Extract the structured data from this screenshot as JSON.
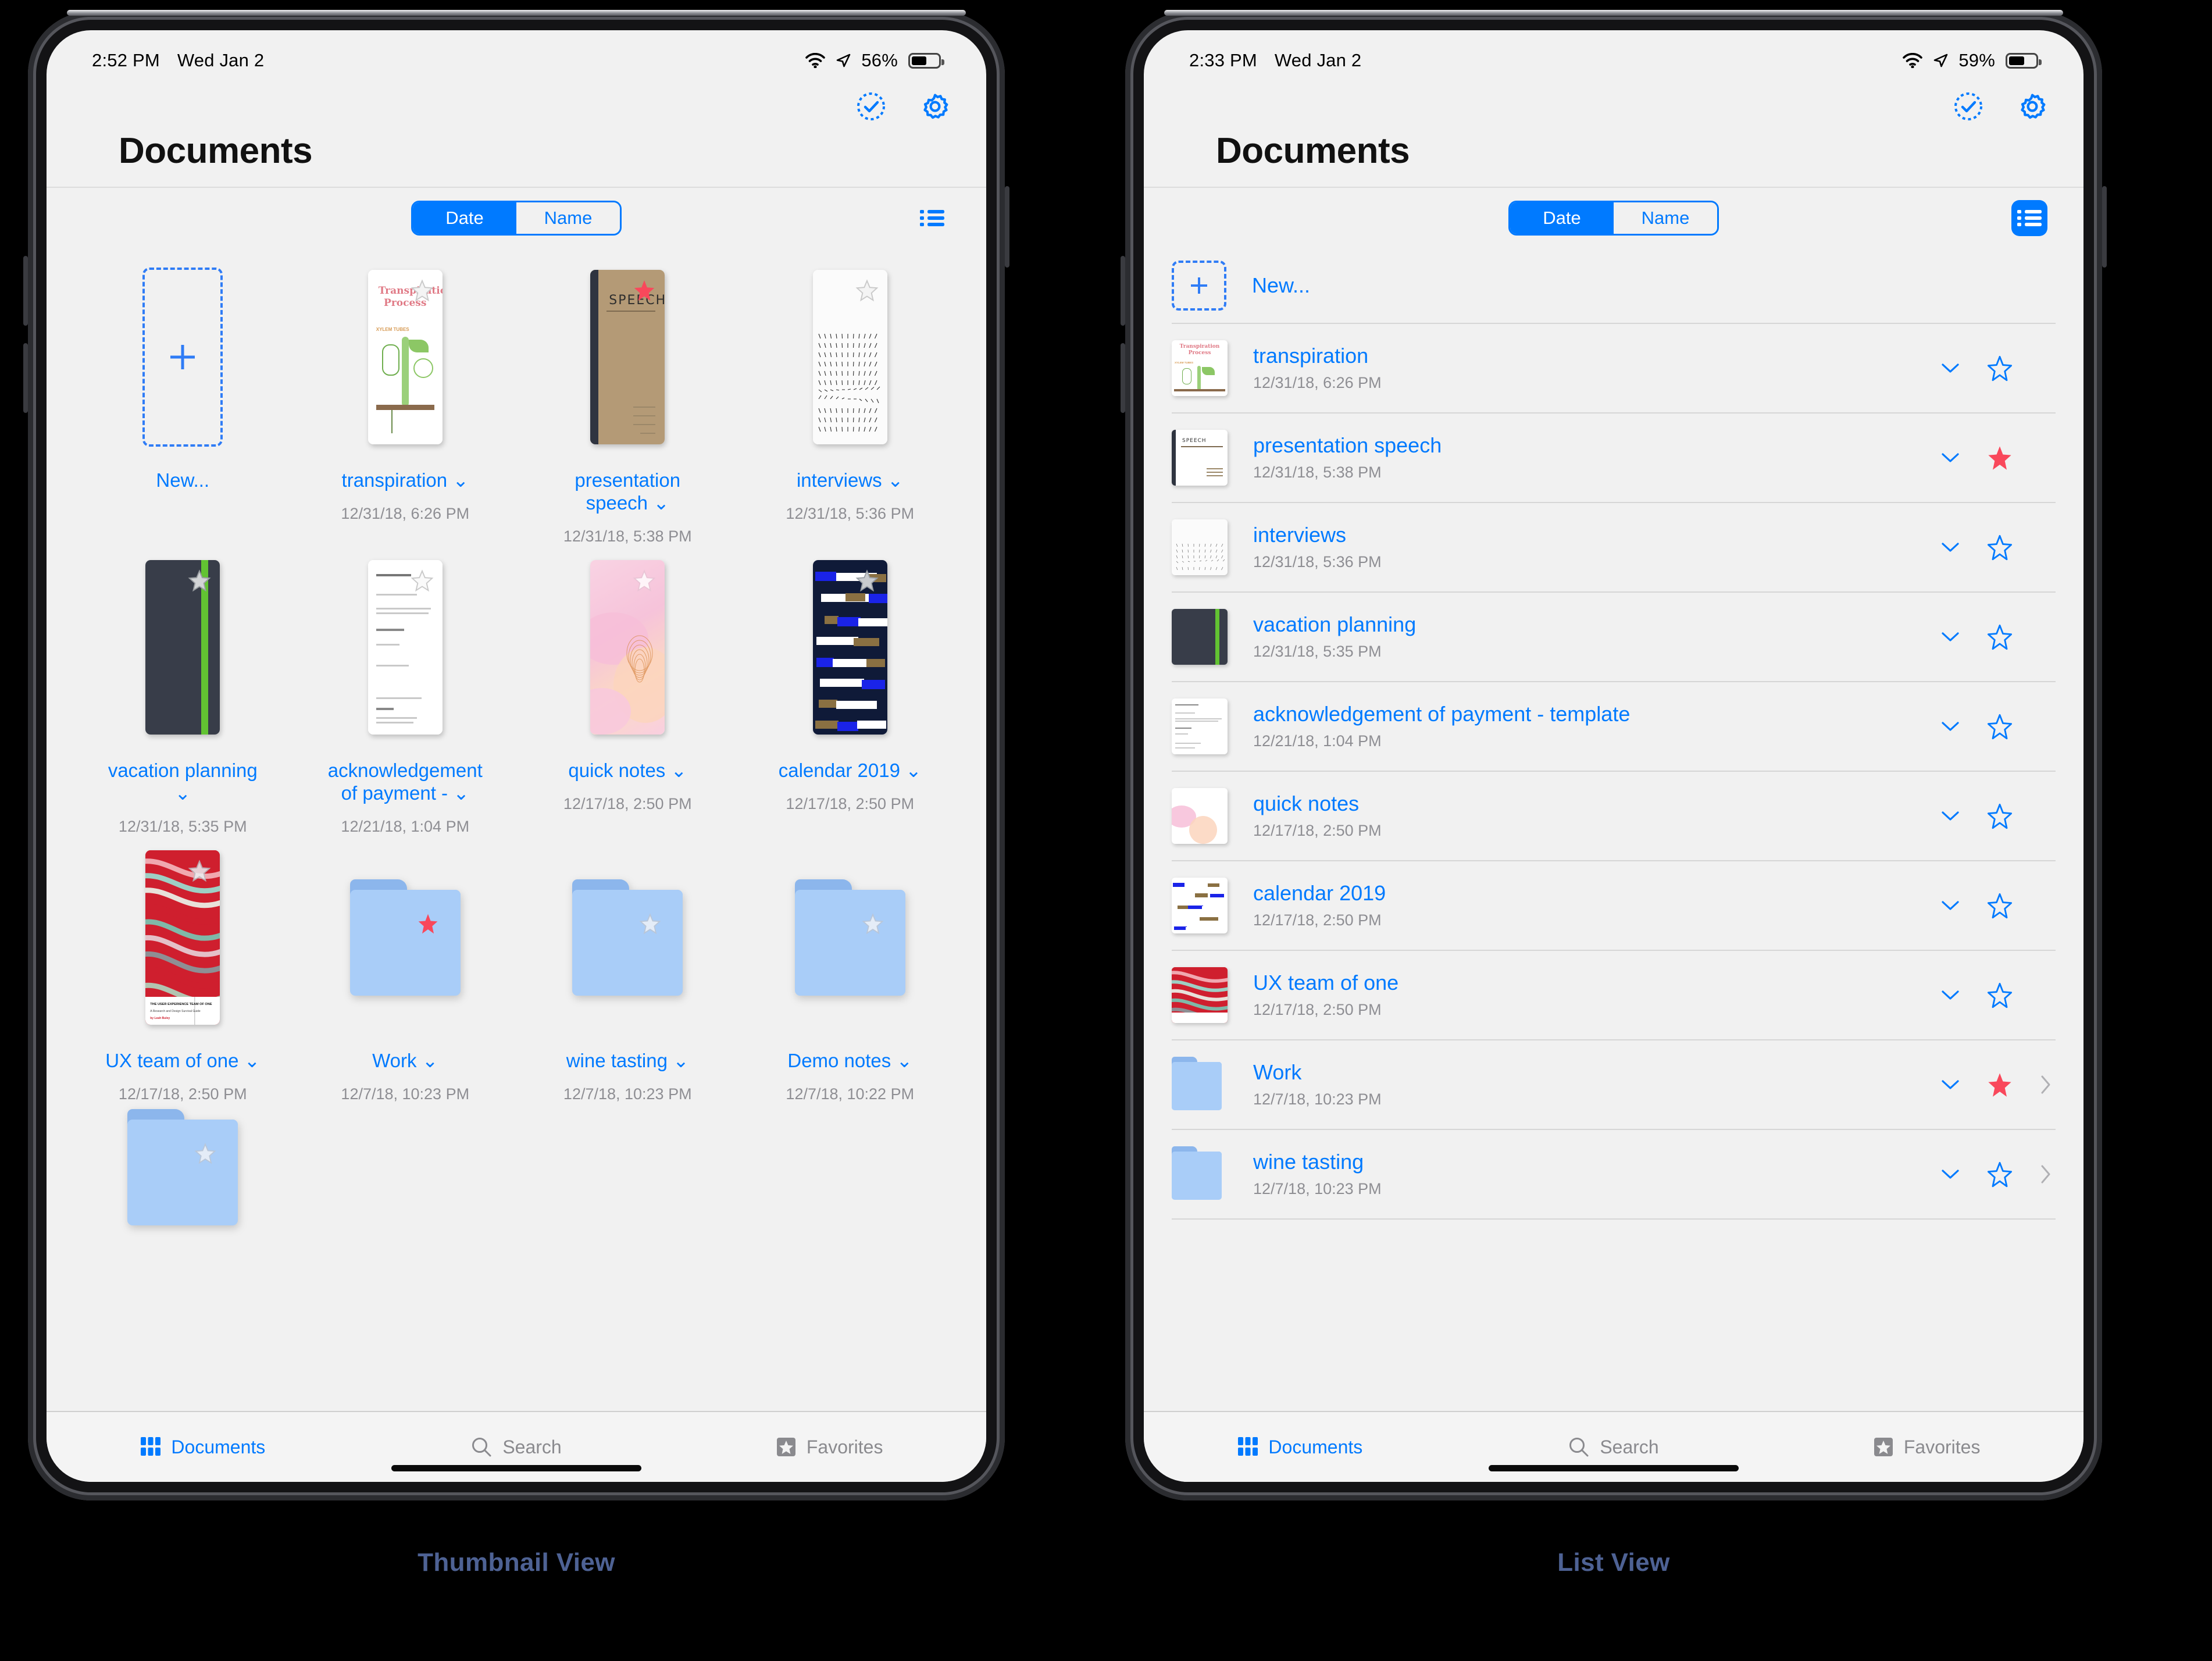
{
  "devices": [
    {
      "id": "left",
      "caption": "Thumbnail View",
      "status": {
        "time": "2:52 PM",
        "date": "Wed Jan 2",
        "battery": "56%"
      },
      "title": "Documents",
      "sort": {
        "options": [
          "Date",
          "Name"
        ],
        "selected": "Date"
      },
      "view_toggle": {
        "icon": "list-view-icon",
        "active": false
      },
      "toolbar": {
        "select_icon": "select-check-circle-icon",
        "settings_icon": "gear-icon"
      }
    },
    {
      "id": "right",
      "caption": "List View",
      "status": {
        "time": "2:33 PM",
        "date": "Wed Jan 2",
        "battery": "59%"
      },
      "title": "Documents",
      "sort": {
        "options": [
          "Date",
          "Name"
        ],
        "selected": "Date"
      },
      "view_toggle": {
        "icon": "list-view-icon",
        "active": true
      },
      "toolbar": {
        "select_icon": "select-check-circle-icon",
        "settings_icon": "gear-icon"
      }
    }
  ],
  "new_item": {
    "label": "New...",
    "icon": "plus-icon"
  },
  "items": [
    {
      "name": "transpiration",
      "date": "12/31/18, 6:26 PM",
      "kind": "doc",
      "art": "transpiration",
      "favorite": false,
      "grid_label": "transpiration"
    },
    {
      "name": "presentation speech",
      "date": "12/31/18, 5:38 PM",
      "kind": "doc",
      "art": "speech",
      "favorite": true,
      "grid_label": "presentation speech"
    },
    {
      "name": "interviews",
      "date": "12/31/18, 5:36 PM",
      "kind": "doc",
      "art": "dots",
      "favorite": false,
      "grid_label": "interviews"
    },
    {
      "name": "vacation planning",
      "date": "12/31/18, 5:35 PM",
      "kind": "doc",
      "art": "notebook",
      "favorite": false,
      "grid_label": "vacation planning"
    },
    {
      "name": "acknowledgement of payment - template",
      "date": "12/21/18, 1:04 PM",
      "kind": "doc",
      "art": "letter",
      "favorite": false,
      "grid_label": "acknowledgement of payment -"
    },
    {
      "name": "quick notes",
      "date": "12/17/18, 2:50 PM",
      "kind": "doc",
      "art": "pink",
      "favorite": false,
      "grid_label": "quick notes"
    },
    {
      "name": "calendar 2019",
      "date": "12/17/18, 2:50 PM",
      "kind": "doc",
      "art": "calendar",
      "favorite": false,
      "grid_label": "calendar 2019"
    },
    {
      "name": "UX team of one",
      "date": "12/17/18, 2:50 PM",
      "kind": "doc",
      "art": "ux",
      "favorite": false,
      "grid_label": "UX team of one"
    },
    {
      "name": "Work",
      "date": "12/7/18, 10:23 PM",
      "kind": "folder",
      "art": "folder",
      "favorite": true,
      "grid_label": "Work"
    },
    {
      "name": "wine tasting",
      "date": "12/7/18, 10:23 PM",
      "kind": "folder",
      "art": "folder",
      "favorite": false,
      "grid_label": "wine tasting"
    },
    {
      "name": "Demo notes",
      "date": "12/7/18, 10:22 PM",
      "kind": "folder",
      "art": "folder",
      "favorite": false,
      "grid_label": "Demo notes"
    },
    {
      "name": "",
      "date": "",
      "kind": "folder",
      "art": "folder",
      "favorite": false,
      "grid_label": ""
    }
  ],
  "tabbar": {
    "tabs": [
      {
        "label": "Documents",
        "icon": "grid-documents-icon",
        "active": true
      },
      {
        "label": "Search",
        "icon": "magnifier-icon",
        "active": false
      },
      {
        "label": "Favorites",
        "icon": "star-square-icon",
        "active": false
      }
    ]
  },
  "colors": {
    "accent": "#007aff",
    "favorite": "#f9485b",
    "folder": "#a9cdf8",
    "caption": "#4e6294",
    "muted": "#8e8e93"
  },
  "icons": {
    "chevron_down": "chevron-down-icon",
    "chevron_right": "chevron-right-icon",
    "star_outline": "star-outline-icon",
    "star_filled": "star-filled-icon"
  }
}
